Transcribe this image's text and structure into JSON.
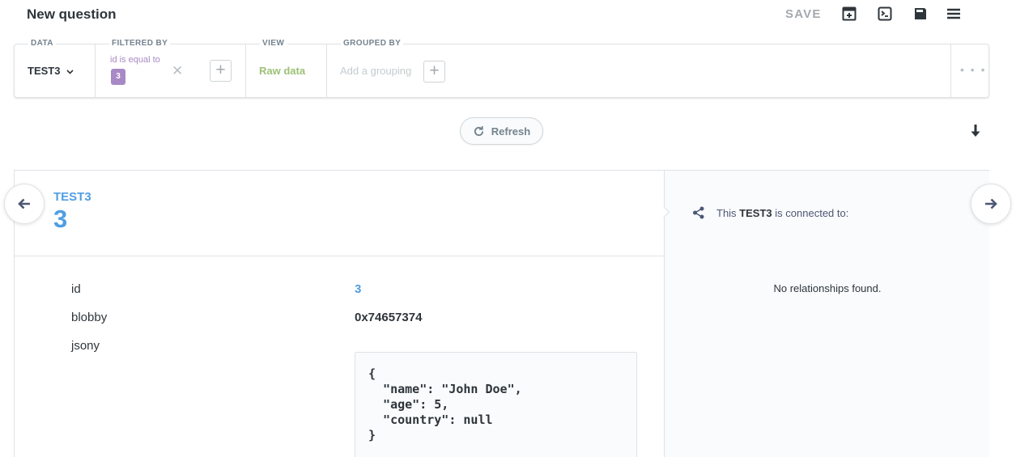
{
  "header": {
    "title": "New question",
    "save_label": "SAVE",
    "icons": [
      "add-to-dashboard-icon",
      "embed-icon",
      "notebook-icon",
      "menu-icon"
    ]
  },
  "query_builder": {
    "data": {
      "label": "DATA",
      "value": "TEST3"
    },
    "filter": {
      "label": "FILTERED BY",
      "text": "id is equal to",
      "value": "3"
    },
    "view": {
      "label": "VIEW",
      "value": "Raw data"
    },
    "grouping": {
      "label": "GROUPED BY",
      "placeholder": "Add a grouping"
    },
    "more": "• • •"
  },
  "toolbar": {
    "refresh_label": "Refresh"
  },
  "object": {
    "table_name": "TEST3",
    "id": "3",
    "fields": [
      {
        "name": "id",
        "value": "3"
      },
      {
        "name": "blobby",
        "value": "0x74657374"
      },
      {
        "name": "jsony",
        "value": "{\n  \"name\": \"John Doe\",\n  \"age\": 5,\n  \"country\": null\n}"
      }
    ]
  },
  "relationships": {
    "prefix": "This",
    "entity": "TEST3",
    "suffix": "is connected to:",
    "empty_message": "No relationships found."
  },
  "colors": {
    "brand": "#509ee3",
    "filter": "#a989c5",
    "view": "#9cc177",
    "text": "#2e353b",
    "muted": "#a3a9ae"
  }
}
